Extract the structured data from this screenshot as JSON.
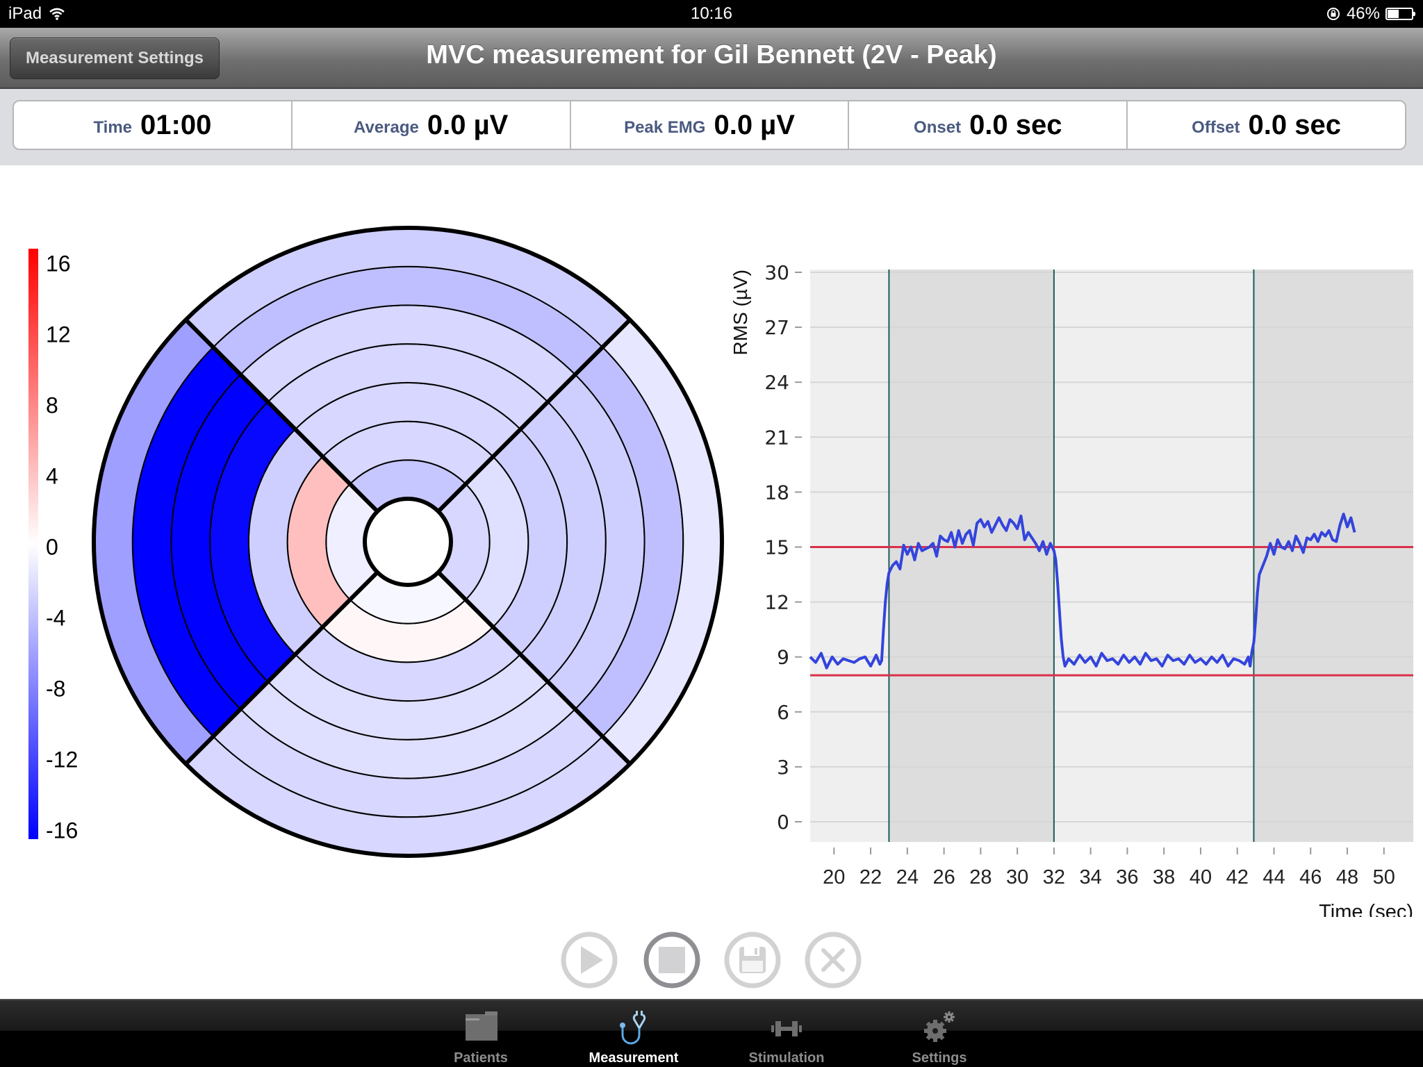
{
  "status_bar": {
    "device": "iPad",
    "time": "10:16",
    "battery_percent": "46%",
    "battery_level": 0.46,
    "icons": [
      "wifi-icon",
      "rotation-lock-icon",
      "battery-icon"
    ]
  },
  "nav_bar": {
    "settings_button": "Measurement Settings",
    "title": "MVC measurement for Gil Bennett (2V - Peak)"
  },
  "stats": [
    {
      "label": "Time",
      "value": "01:00"
    },
    {
      "label": "Average",
      "value": "0.0 µV"
    },
    {
      "label": "Peak EMG",
      "value": "0.0 µV"
    },
    {
      "label": "Onset",
      "value": "0.0 sec"
    },
    {
      "label": "Offset",
      "value": "0.0 sec"
    }
  ],
  "colors": {
    "signal": "#3344dd",
    "threshold": "#d9304a",
    "marker": "#1d5a5a",
    "band_light": "#efefef",
    "band_dark": "#dddddd",
    "scale_max": "#ff0000",
    "scale_mid": "#ffffff",
    "scale_min": "#0000ff",
    "active_tab": "#5aa8e6"
  },
  "chart_data": [
    {
      "type": "heatmap",
      "subtype": "polar-ring-segments",
      "title": "",
      "colorbar": {
        "min": -16,
        "max": 16,
        "ticks": [
          "16",
          "12",
          "8",
          "4",
          "0",
          "-4",
          "-8",
          "-12",
          "-16"
        ],
        "tick_values": [
          16,
          12,
          8,
          4,
          0,
          -4,
          -8,
          -12,
          -16
        ]
      },
      "quadrants": [
        "top",
        "right",
        "bottom",
        "left"
      ],
      "rings_inner_to_outer": 7,
      "values": {
        "top": [
          -3.5,
          -2.5,
          -2.5,
          -2.5,
          -2.5,
          -4,
          -3
        ],
        "right": [
          -2.5,
          -2,
          -3,
          -3,
          -3,
          -4,
          -1.5
        ],
        "bottom": [
          -0.5,
          0.5,
          -2.5,
          -2,
          -2,
          -2.5,
          -2.5
        ],
        "left": [
          -1,
          4,
          -3,
          -15.5,
          -16,
          -16,
          -6
        ]
      }
    },
    {
      "type": "line",
      "title": "",
      "xlabel": "Time (sec)",
      "ylabel": "RMS (µV)",
      "xlim": [
        18.7,
        51.6
      ],
      "ylim": [
        0,
        30
      ],
      "x_ticks": [
        "20",
        "22",
        "24",
        "26",
        "28",
        "30",
        "32",
        "34",
        "36",
        "38",
        "40",
        "42",
        "44",
        "46",
        "48",
        "50"
      ],
      "y_ticks": [
        "0",
        "3",
        "6",
        "9",
        "12",
        "15",
        "18",
        "21",
        "24",
        "27",
        "30"
      ],
      "grid": true,
      "thresholds": [
        15,
        8
      ],
      "markers": [
        23.0,
        32.0,
        42.9
      ],
      "bands": [
        {
          "from": 18.7,
          "to": 23.0,
          "shade": "light"
        },
        {
          "from": 23.0,
          "to": 32.0,
          "shade": "dark"
        },
        {
          "from": 32.0,
          "to": 42.9,
          "shade": "light"
        },
        {
          "from": 42.9,
          "to": 51.6,
          "shade": "dark"
        }
      ],
      "series": [
        {
          "name": "RMS",
          "x": [
            18.7,
            19.0,
            19.3,
            19.6,
            19.9,
            20.2,
            20.5,
            20.8,
            21.1,
            21.4,
            21.7,
            22.0,
            22.3,
            22.5,
            22.6,
            22.7,
            22.8,
            22.9,
            23.0,
            23.2,
            23.4,
            23.6,
            23.8,
            24.0,
            24.2,
            24.4,
            24.6,
            24.8,
            25.0,
            25.2,
            25.4,
            25.6,
            25.8,
            26.0,
            26.2,
            26.4,
            26.6,
            26.8,
            27.0,
            27.2,
            27.4,
            27.6,
            27.8,
            28.0,
            28.2,
            28.4,
            28.6,
            28.8,
            29.0,
            29.2,
            29.4,
            29.6,
            29.8,
            30.0,
            30.2,
            30.4,
            30.6,
            30.8,
            31.0,
            31.2,
            31.4,
            31.6,
            31.8,
            32.0,
            32.1,
            32.2,
            32.3,
            32.4,
            32.5,
            32.6,
            32.8,
            33.1,
            33.4,
            33.7,
            34.0,
            34.3,
            34.6,
            34.9,
            35.2,
            35.5,
            35.8,
            36.1,
            36.4,
            36.7,
            37.0,
            37.3,
            37.6,
            37.9,
            38.2,
            38.5,
            38.8,
            39.1,
            39.4,
            39.7,
            40.0,
            40.3,
            40.6,
            40.9,
            41.2,
            41.5,
            41.8,
            42.1,
            42.4,
            42.6,
            42.7,
            42.8,
            42.9,
            43.0,
            43.1,
            43.2,
            43.4,
            43.6,
            43.8,
            44.0,
            44.2,
            44.4,
            44.6,
            44.8,
            45.0,
            45.2,
            45.4,
            45.6,
            45.8,
            46.0,
            46.2,
            46.4,
            46.6,
            46.8,
            47.0,
            47.2,
            47.4,
            47.6,
            47.8,
            48.0,
            48.2,
            48.4,
            48.6
          ],
          "y": [
            9.0,
            8.7,
            9.2,
            8.4,
            9.0,
            8.6,
            8.9,
            8.8,
            8.7,
            8.9,
            9.0,
            8.5,
            9.1,
            8.6,
            8.8,
            10.5,
            12.0,
            13.0,
            13.6,
            14.0,
            14.2,
            13.8,
            15.1,
            14.6,
            15.0,
            14.3,
            15.2,
            14.8,
            14.9,
            15.0,
            15.2,
            14.5,
            15.6,
            15.4,
            15.3,
            15.8,
            15.0,
            15.9,
            15.2,
            15.7,
            15.9,
            15.1,
            16.3,
            16.5,
            16.1,
            16.4,
            15.8,
            16.2,
            16.6,
            16.2,
            15.9,
            16.5,
            16.3,
            16.0,
            16.7,
            15.4,
            15.8,
            15.5,
            15.2,
            14.8,
            15.3,
            14.6,
            15.2,
            14.8,
            14.3,
            13.0,
            11.5,
            10.0,
            9.0,
            8.5,
            8.9,
            8.6,
            9.1,
            8.7,
            9.0,
            8.5,
            9.2,
            8.8,
            8.9,
            8.6,
            9.1,
            8.7,
            9.0,
            8.6,
            9.2,
            8.8,
            8.9,
            8.5,
            9.1,
            8.8,
            8.9,
            8.6,
            9.1,
            8.7,
            8.9,
            8.6,
            9.0,
            8.7,
            9.1,
            8.5,
            8.9,
            8.8,
            8.6,
            9.0,
            8.5,
            9.3,
            9.8,
            11.0,
            12.5,
            13.5,
            14.0,
            14.5,
            15.2,
            14.6,
            15.4,
            15.0,
            14.9,
            15.3,
            14.8,
            15.6,
            15.2,
            14.7,
            15.5,
            15.4,
            15.7,
            15.3,
            15.8,
            15.6,
            15.9,
            15.4,
            15.3,
            16.2,
            16.8,
            16.1,
            16.6,
            15.8
          ]
        }
      ]
    }
  ],
  "controls": [
    {
      "name": "play",
      "icon": "play-icon",
      "enabled": false
    },
    {
      "name": "stop",
      "icon": "stop-icon",
      "enabled": true
    },
    {
      "name": "save",
      "icon": "floppy-disk-icon",
      "enabled": false
    },
    {
      "name": "cancel",
      "icon": "close-icon",
      "enabled": false
    }
  ],
  "tab_bar": {
    "tabs": [
      {
        "label": "Patients",
        "icon": "folder-icon",
        "active": false
      },
      {
        "label": "Measurement",
        "icon": "stethoscope-icon",
        "active": true
      },
      {
        "label": "Stimulation",
        "icon": "dumbbell-icon",
        "active": false
      },
      {
        "label": "Settings",
        "icon": "gears-icon",
        "active": false
      }
    ]
  }
}
